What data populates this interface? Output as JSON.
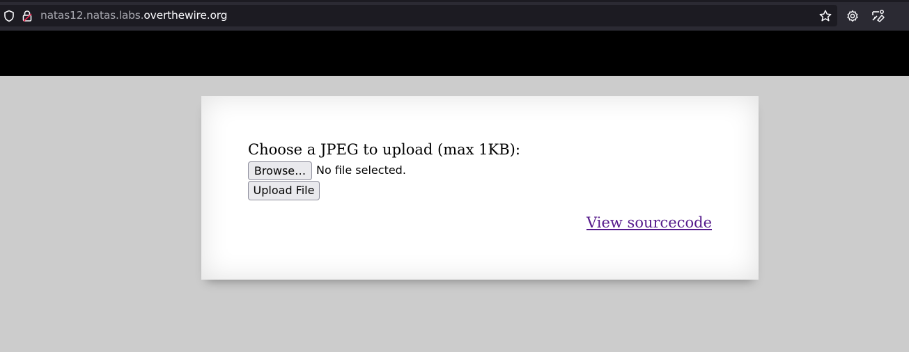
{
  "browser": {
    "url_prefix": "natas12.natas.labs.",
    "url_domain": "overthewire.org"
  },
  "icons": {
    "shield": "shield-icon",
    "lock": "lock-icon",
    "bookmark": "star-icon",
    "settings": "gear-icon",
    "extensions": "tools-icon"
  },
  "colors": {
    "toolbar_bg": "#2b2a33",
    "urlbar_bg": "#1c1b22",
    "header_bg": "#000000",
    "page_bg": "#cccccc",
    "card_bg": "#ffffff",
    "link_visited": "#551a8b",
    "lock_warning": "#e22850"
  },
  "content": {
    "prompt": "Choose a JPEG to upload (max 1KB):",
    "browse_label": "Browse…",
    "file_status": "No file selected.",
    "upload_label": "Upload File",
    "source_link": "View sourcecode"
  }
}
